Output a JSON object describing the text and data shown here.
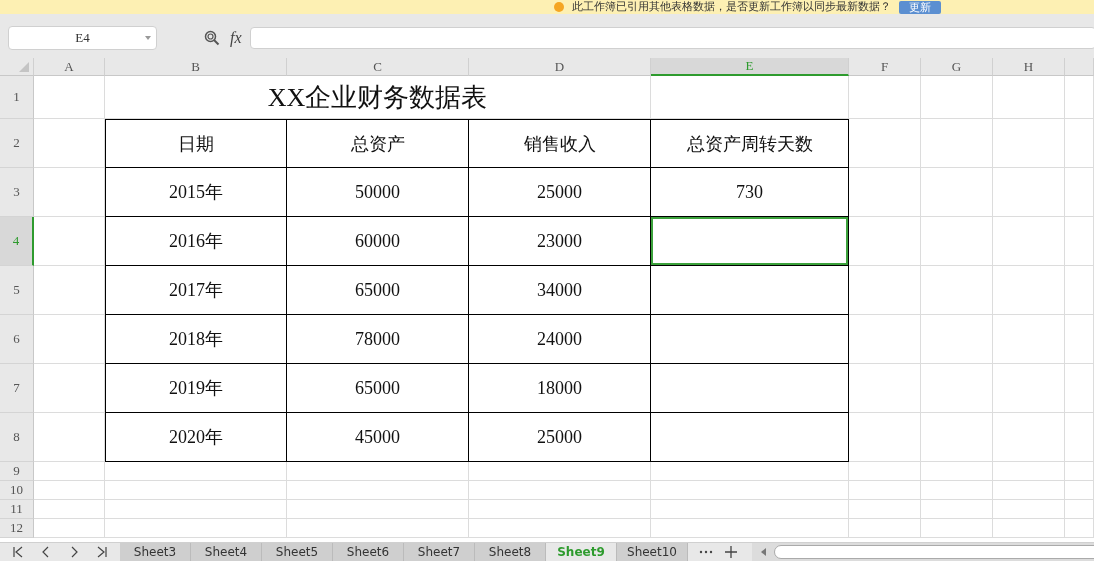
{
  "notification": {
    "text": "此工作簿已引用其他表格数据，是否更新工作簿以同步最新数据？",
    "button": "更新"
  },
  "formula_bar": {
    "name_box": "E4",
    "function_label": "fx"
  },
  "columns": [
    {
      "label": "A",
      "selected": false
    },
    {
      "label": "B",
      "selected": false
    },
    {
      "label": "C",
      "selected": false
    },
    {
      "label": "D",
      "selected": false
    },
    {
      "label": "E",
      "selected": true
    },
    {
      "label": "F",
      "selected": false
    },
    {
      "label": "G",
      "selected": false
    },
    {
      "label": "H",
      "selected": false
    }
  ],
  "rows": [
    {
      "label": "1",
      "selected": false
    },
    {
      "label": "2",
      "selected": false
    },
    {
      "label": "3",
      "selected": false
    },
    {
      "label": "4",
      "selected": true
    },
    {
      "label": "5",
      "selected": false
    },
    {
      "label": "6",
      "selected": false
    },
    {
      "label": "7",
      "selected": false
    },
    {
      "label": "8",
      "selected": false
    },
    {
      "label": "9",
      "selected": false
    },
    {
      "label": "10",
      "selected": false
    },
    {
      "label": "11",
      "selected": false
    },
    {
      "label": "12",
      "selected": false
    }
  ],
  "title": "XX企业财务数据表",
  "table": {
    "header": [
      "日期",
      "总资产",
      "销售收入",
      "总资产周转天数"
    ],
    "rows": [
      [
        "2015年",
        "50000",
        "25000",
        "730"
      ],
      [
        "2016年",
        "60000",
        "23000"
      ],
      [
        "2017年",
        "65000",
        "34000"
      ],
      [
        "2018年",
        "78000",
        "24000"
      ],
      [
        "2019年",
        "65000",
        "18000"
      ],
      [
        "2020年",
        "45000",
        "25000"
      ]
    ]
  },
  "sheet_tabs": [
    {
      "label": "Sheet3",
      "selected": false
    },
    {
      "label": "Sheet4",
      "selected": false
    },
    {
      "label": "Sheet5",
      "selected": false
    },
    {
      "label": "Sheet6",
      "selected": false
    },
    {
      "label": "Sheet7",
      "selected": false
    },
    {
      "label": "Sheet8",
      "selected": false
    },
    {
      "label": "Sheet9",
      "selected": true
    },
    {
      "label": "Sheet10",
      "selected": false
    }
  ]
}
